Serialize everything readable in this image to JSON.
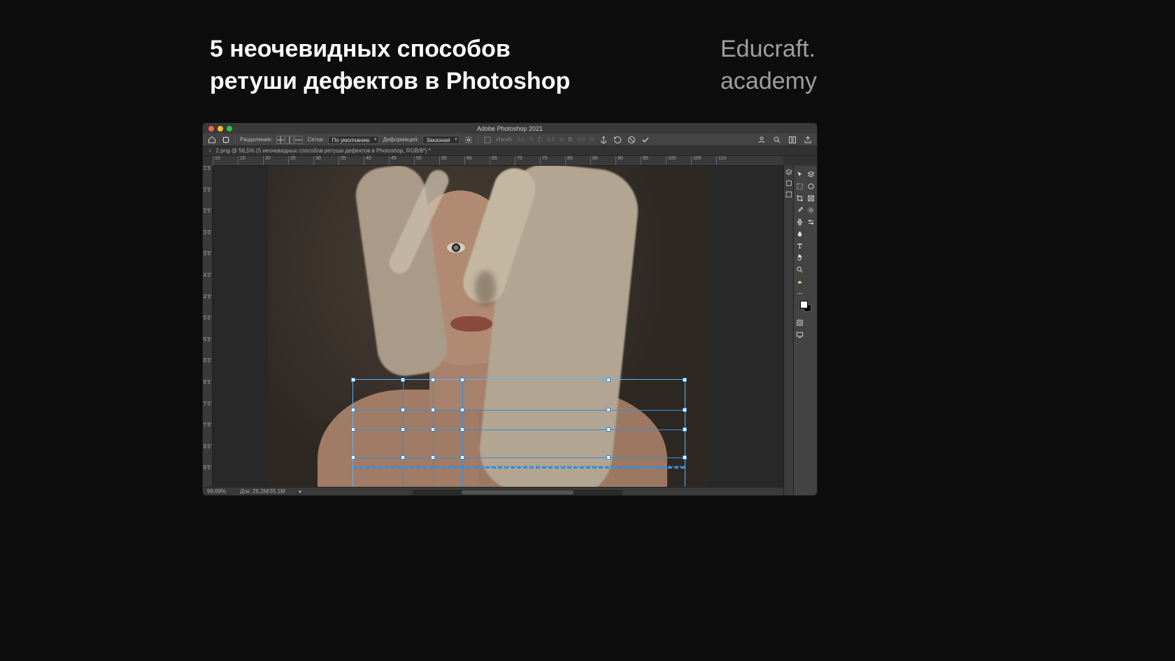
{
  "heading": {
    "line1": "5 неочевидных способов",
    "line2": "ретуши дефектов в Photoshop"
  },
  "brand": {
    "line1": "Educraft.",
    "line2": "academy"
  },
  "titlebar": {
    "app_title": "Adobe Photoshop 2021"
  },
  "optionsBar": {
    "split_label": "Разделение:",
    "grid_label": "Сетка:",
    "grid_value": "По умолчанию",
    "deform_label": "Деформация:",
    "deform_value": "Заказная",
    "bend_label": "Изгиб:",
    "bend_value": "0,0",
    "percent1": "%",
    "h_label": "Г:",
    "h_value": "0,0",
    "percent2": "%",
    "v_label": "В:",
    "v_value": "0,0",
    "percent3": "%"
  },
  "docTab": {
    "label": "2.png @ 56,5% (5 неочевидных способов ретуши дефектов в Photoshop, RGB/8*) *"
  },
  "rulerH": [
    "10",
    "15",
    "20",
    "25",
    "30",
    "35",
    "40",
    "45",
    "50",
    "55",
    "60",
    "65",
    "70",
    "75",
    "80",
    "85",
    "90",
    "95",
    "100",
    "105",
    "110"
  ],
  "rulerV": [
    "1 5",
    "2 0",
    "2 5",
    "3 0",
    "3 5",
    "4 0",
    "4 5",
    "5 0",
    "5 5",
    "6 0",
    "6 5",
    "7 0",
    "7 5",
    "8 0",
    "8 5"
  ],
  "statusBar": {
    "zoom": "99,69%",
    "doc": "Док: 26,2M/35,1M"
  },
  "tools": {
    "row1": [
      "move",
      "artboard"
    ],
    "row2": [
      "marquee",
      "lasso"
    ],
    "row3": [
      "crop",
      "frame"
    ],
    "row4": [
      "eyedropper",
      "brush-set"
    ],
    "row5": [
      "healing",
      "adjust"
    ],
    "row6": [
      "blur",
      ""
    ],
    "row7": [
      "type",
      ""
    ],
    "row8": [
      "hand",
      ""
    ],
    "row9": [
      "zoom",
      ""
    ],
    "row10": [
      "banana",
      ""
    ]
  }
}
